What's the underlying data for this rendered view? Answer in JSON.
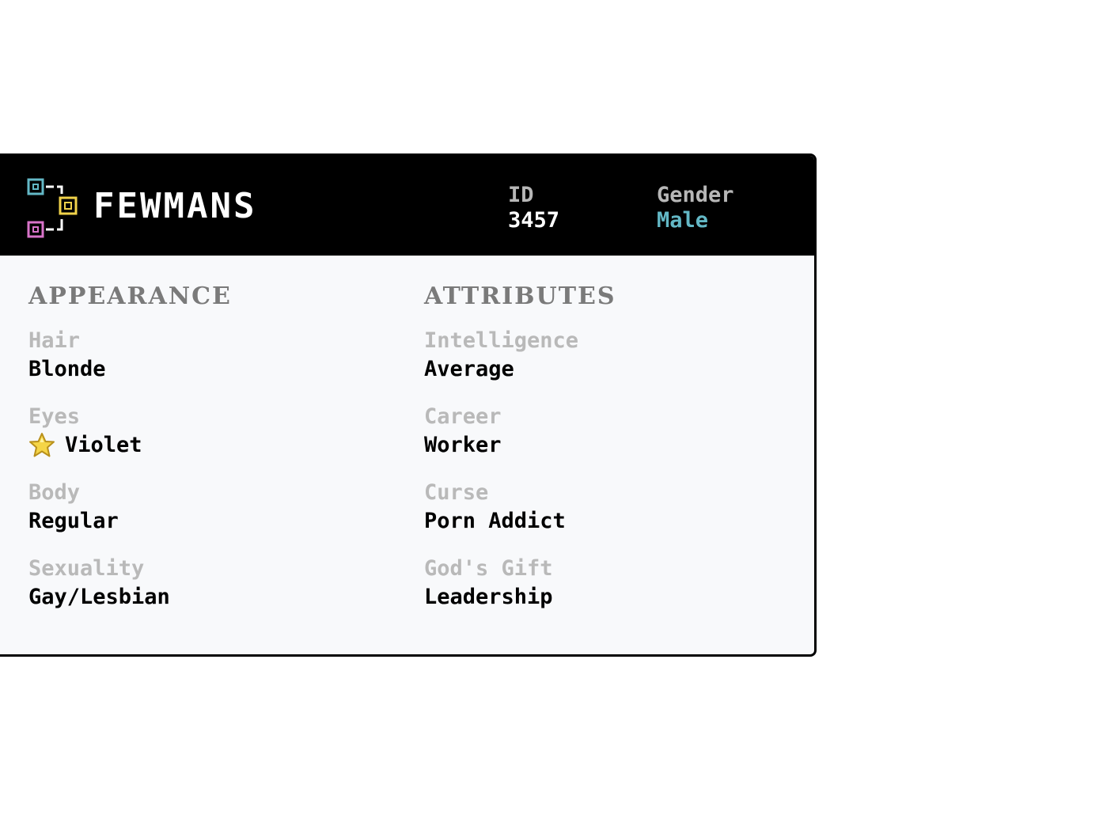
{
  "header": {
    "brand": "FEWMANS",
    "id_label": "ID",
    "id_value": "3457",
    "gender_label": "Gender",
    "gender_value": "Male",
    "colors": {
      "gender_value": "#63b8c6",
      "logo_cyan": "#63b8c6",
      "logo_yellow": "#f1d24a",
      "logo_pink": "#d873c9"
    }
  },
  "appearance": {
    "title": "APPEARANCE",
    "fields": [
      {
        "label": "Hair",
        "value": "Blonde"
      },
      {
        "label": "Eyes",
        "value": "Violet",
        "icon": "star-icon"
      },
      {
        "label": "Body",
        "value": "Regular"
      },
      {
        "label": "Sexuality",
        "value": "Gay/Lesbian"
      }
    ]
  },
  "attributes": {
    "title": "ATTRIBUTES",
    "fields": [
      {
        "label": "Intelligence",
        "value": "Average"
      },
      {
        "label": "Career",
        "value": "Worker"
      },
      {
        "label": "Curse",
        "value": "Porn Addict"
      },
      {
        "label": "God's Gift",
        "value": "Leadership"
      }
    ]
  }
}
